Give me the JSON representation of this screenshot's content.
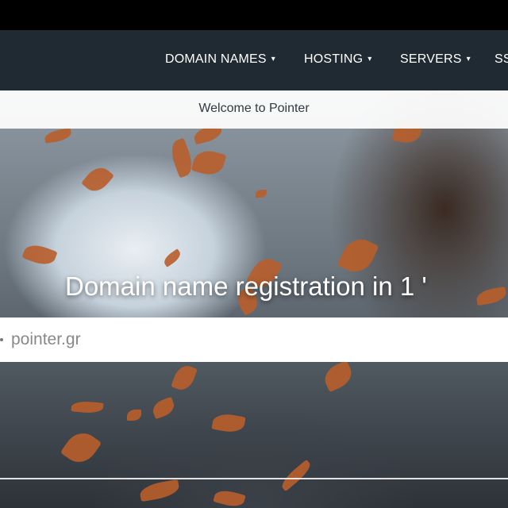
{
  "nav": {
    "items": [
      {
        "label": "DOMAIN NAMES",
        "caret": "▾"
      },
      {
        "label": "HOSTING",
        "caret": "▾"
      },
      {
        "label": "SERVERS",
        "caret": "▾"
      },
      {
        "label": "SS"
      }
    ]
  },
  "welcome": {
    "text": "Welcome to Pointer"
  },
  "hero": {
    "headline": "Domain name registration in 1 '",
    "search": {
      "placeholder": "pointer.gr"
    }
  }
}
